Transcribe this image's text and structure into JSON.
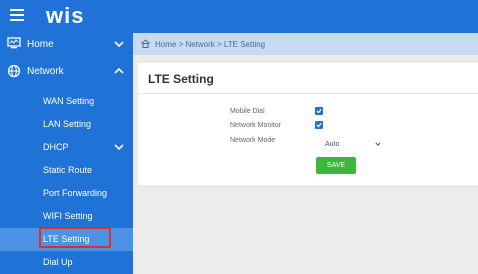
{
  "header": {
    "logo": "wis",
    "menu_icon": "hamburger-icon"
  },
  "sidebar": {
    "home": {
      "label": "Home",
      "icon": "monitor-icon"
    },
    "network": {
      "label": "Network",
      "icon": "globe-icon"
    },
    "items": [
      {
        "label": "WAN Setting"
      },
      {
        "label": "LAN Setting"
      },
      {
        "label": "DHCP"
      },
      {
        "label": "Static Route"
      },
      {
        "label": "Port Forwarding"
      },
      {
        "label": "WIFI Setting"
      },
      {
        "label": "LTE Setting",
        "active": true
      },
      {
        "label": "Dial Up"
      }
    ]
  },
  "breadcrumb": {
    "text": "Home > Network > LTE Setting",
    "icon": "home-icon"
  },
  "panel": {
    "title": "LTE Setting",
    "fields": {
      "mobile_dial": {
        "label": "Mobile Dial",
        "checked": true
      },
      "network_monitor": {
        "label": "Network Monitor",
        "checked": true
      },
      "network_mode": {
        "label": "Network Mode",
        "value": "Auto"
      }
    },
    "save_label": "SAVE"
  },
  "colors": {
    "primary": "#2172d8",
    "save": "#3ab83a",
    "highlight": "#d9302c"
  }
}
